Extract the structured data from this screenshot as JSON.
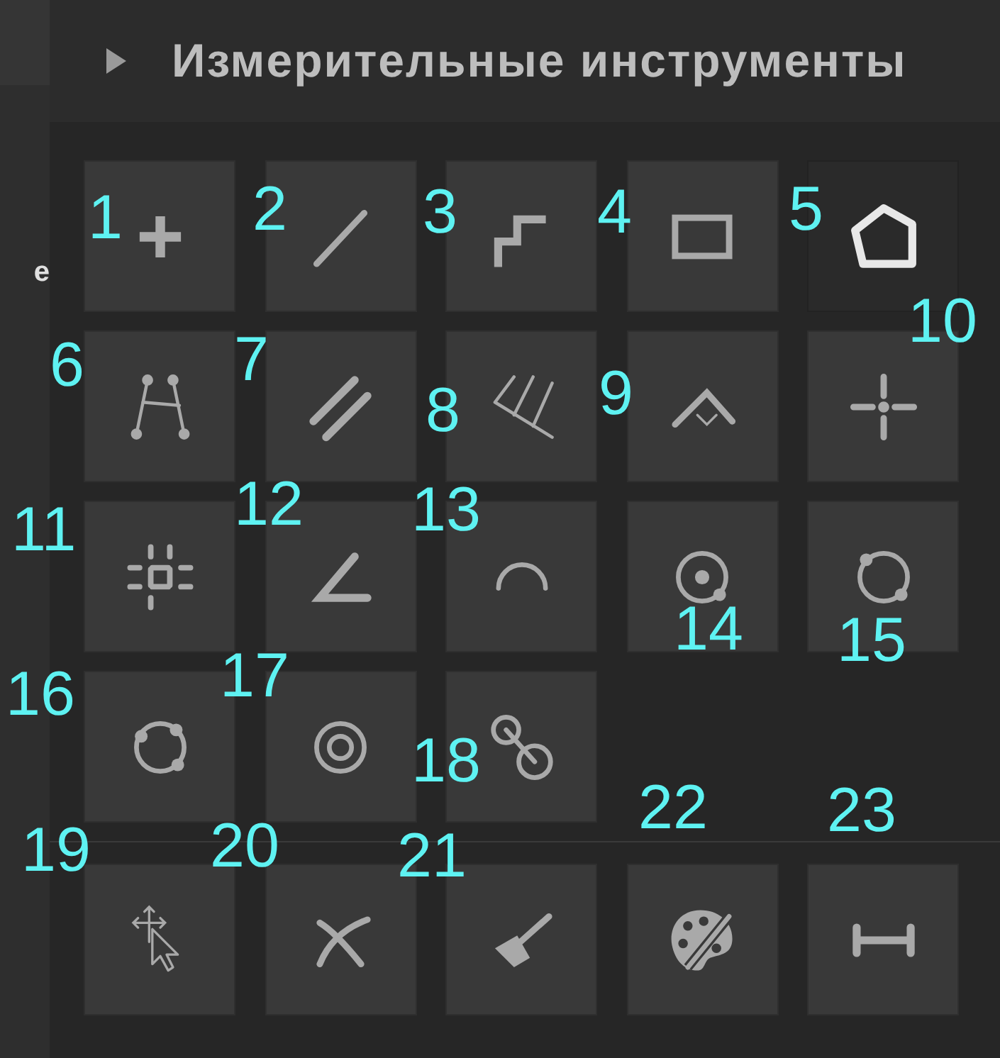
{
  "side_label": "e",
  "panel": {
    "title": "Измерительные инструменты",
    "expanded": false
  },
  "tool_groups": [
    [
      {
        "kind": "plus",
        "selected": false
      },
      {
        "kind": "line",
        "selected": false
      },
      {
        "kind": "steps",
        "selected": false
      },
      {
        "kind": "rectangle",
        "selected": false
      },
      {
        "kind": "pentagon",
        "selected": true
      },
      {
        "kind": "points",
        "selected": false
      },
      {
        "kind": "parallel",
        "selected": false
      },
      {
        "kind": "comb",
        "selected": false
      },
      {
        "kind": "perpendicular",
        "selected": false
      },
      {
        "kind": "crosshair",
        "selected": false
      },
      {
        "kind": "grid",
        "selected": false
      },
      {
        "kind": "angle",
        "selected": false
      },
      {
        "kind": "arc",
        "selected": false
      },
      {
        "kind": "circle-center",
        "selected": false
      },
      {
        "kind": "circle-two",
        "selected": false
      },
      {
        "kind": "circle-three",
        "selected": false
      },
      {
        "kind": "concentric",
        "selected": false
      },
      {
        "kind": "two-circles",
        "selected": false
      }
    ],
    [
      {
        "kind": "move",
        "selected": false
      },
      {
        "kind": "curves",
        "selected": false
      },
      {
        "kind": "brush",
        "selected": false
      },
      {
        "kind": "palette",
        "selected": false
      },
      {
        "kind": "dimension",
        "selected": false
      }
    ]
  ],
  "annotations": [
    {
      "label": "1"
    },
    {
      "label": "2"
    },
    {
      "label": "3"
    },
    {
      "label": "4"
    },
    {
      "label": "5"
    },
    {
      "label": "6"
    },
    {
      "label": "7"
    },
    {
      "label": "8"
    },
    {
      "label": "9"
    },
    {
      "label": "10"
    },
    {
      "label": "11"
    },
    {
      "label": "12"
    },
    {
      "label": "13"
    },
    {
      "label": "14"
    },
    {
      "label": "15"
    },
    {
      "label": "16"
    },
    {
      "label": "17"
    },
    {
      "label": "18"
    },
    {
      "label": "19"
    },
    {
      "label": "20"
    },
    {
      "label": "21"
    },
    {
      "label": "22"
    },
    {
      "label": "23"
    }
  ]
}
